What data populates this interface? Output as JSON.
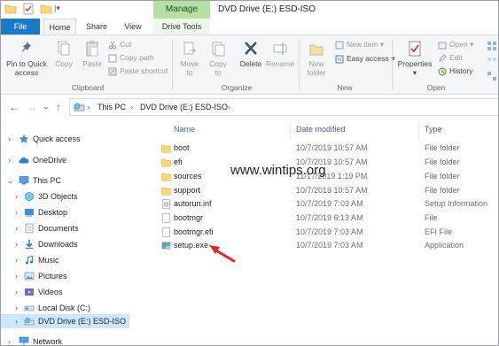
{
  "titlebar": {
    "manage_label": "Manage",
    "title": "DVD Drive (E:) ESD-ISO"
  },
  "tabs": {
    "file": "File",
    "home": "Home",
    "share": "Share",
    "view": "View",
    "drive_tools": "Drive Tools"
  },
  "ribbon": {
    "clipboard": {
      "pin": "Pin to Quick access",
      "copy": "Copy",
      "paste": "Paste",
      "cut": "Cut",
      "copy_path": "Copy path",
      "paste_shortcut": "Paste shortcut",
      "group": "Clipboard"
    },
    "organize": {
      "move_to": "Move to",
      "copy_to": "Copy to",
      "delete": "Delete",
      "rename": "Rename",
      "group": "Organize"
    },
    "new": {
      "new_folder": "New folder",
      "new_item": "New item",
      "easy_access": "Easy access",
      "group": "New"
    },
    "open": {
      "properties": "Properties",
      "open": "Open",
      "edit": "Edit",
      "history": "History",
      "group": "Open"
    }
  },
  "address": {
    "crumbs": [
      "This PC",
      "DVD Drive (E:) ESD-ISO"
    ]
  },
  "navpane": {
    "items": [
      {
        "label": "Quick access",
        "icon": "star-icon"
      },
      {
        "label": "OneDrive",
        "icon": "cloud-icon"
      },
      {
        "label": "This PC",
        "icon": "computer-icon"
      },
      {
        "label": "3D Objects",
        "icon": "cube-icon"
      },
      {
        "label": "Desktop",
        "icon": "desktop-icon"
      },
      {
        "label": "Documents",
        "icon": "documents-icon"
      },
      {
        "label": "Downloads",
        "icon": "download-icon"
      },
      {
        "label": "Music",
        "icon": "music-icon"
      },
      {
        "label": "Pictures",
        "icon": "pictures-icon"
      },
      {
        "label": "Videos",
        "icon": "videos-icon"
      },
      {
        "label": "Local Disk (C:)",
        "icon": "disk-icon"
      },
      {
        "label": "DVD Drive (E:) ESD-ISO",
        "icon": "dvd-icon"
      },
      {
        "label": "Network",
        "icon": "network-icon"
      }
    ]
  },
  "filelist": {
    "headers": {
      "name": "Name",
      "date": "Date modified",
      "type": "Type"
    },
    "rows": [
      {
        "name": "boot",
        "date": "10/7/2019 10:57 AM",
        "type": "File folder",
        "icon": "folder-icon"
      },
      {
        "name": "efi",
        "date": "10/7/2019 10:57 AM",
        "type": "File folder",
        "icon": "folder-icon"
      },
      {
        "name": "sources",
        "date": "11/17/2019 1:19 PM",
        "type": "File folder",
        "icon": "folder-icon"
      },
      {
        "name": "support",
        "date": "10/7/2019 10:57 AM",
        "type": "File folder",
        "icon": "folder-icon"
      },
      {
        "name": "autorun.inf",
        "date": "10/7/2019 7:03 AM",
        "type": "Setup Information",
        "icon": "settings-file-icon"
      },
      {
        "name": "bootmgr",
        "date": "10/7/2019 6:13 AM",
        "type": "File",
        "icon": "file-icon"
      },
      {
        "name": "bootmgr.efi",
        "date": "10/7/2019 7:03 AM",
        "type": "EFI File",
        "icon": "file-icon"
      },
      {
        "name": "setup.exe",
        "date": "10/7/2019 7:03 AM",
        "type": "Application",
        "icon": "setup-app-icon"
      }
    ]
  },
  "watermark": "www.wintips.org",
  "colors": {
    "file_tab": "#1979ca",
    "manage_tab": "#b6dfa5",
    "selection": "#cce8ff",
    "folder": "#f8d775",
    "arrow": "#e8262b"
  }
}
